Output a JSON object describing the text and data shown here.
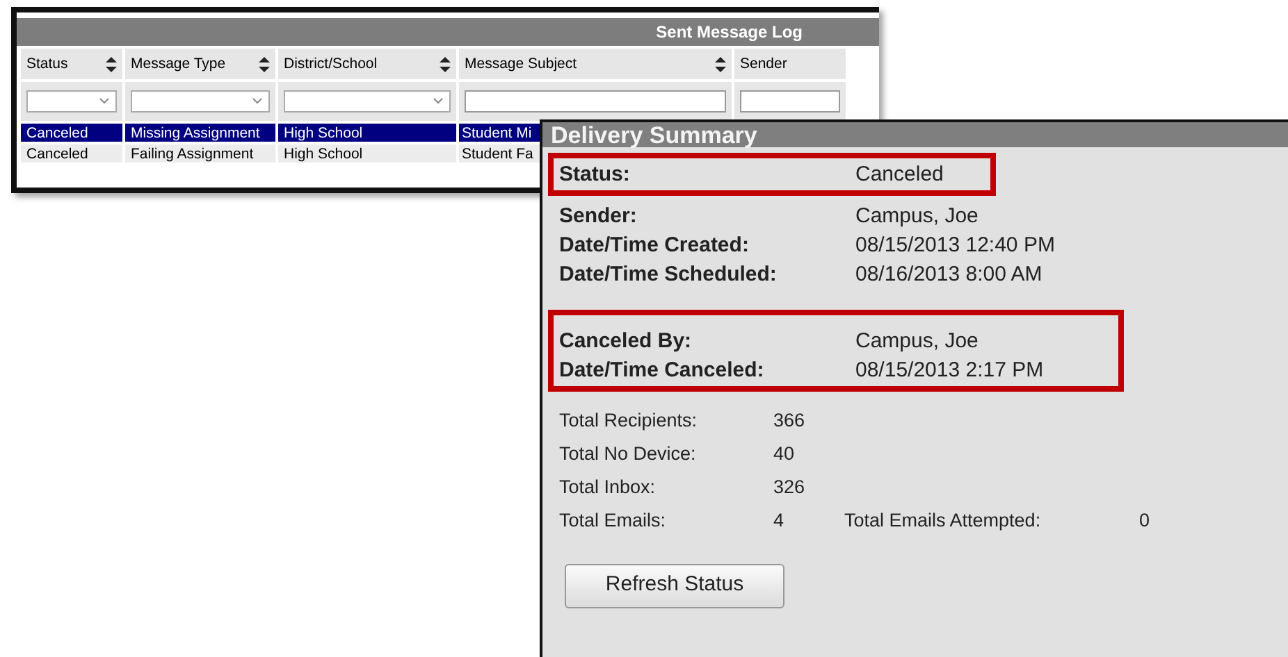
{
  "log_window": {
    "title": "Sent Message Log",
    "columns": [
      {
        "label": "Status",
        "sortable": true,
        "filter": {
          "kind": "dropdown"
        }
      },
      {
        "label": "Message Type",
        "sortable": true,
        "filter": {
          "kind": "dropdown"
        }
      },
      {
        "label": "District/School",
        "sortable": true,
        "filter": {
          "kind": "dropdown"
        }
      },
      {
        "label": "Message Subject",
        "sortable": true,
        "filter": {
          "kind": "text"
        }
      },
      {
        "label": "Sender",
        "sortable": false,
        "filter": {
          "kind": "text"
        }
      }
    ],
    "rows": [
      {
        "selected": true,
        "cells": [
          "Canceled",
          "Missing Assignment",
          "High School",
          "Student Mi"
        ]
      },
      {
        "selected": false,
        "cells": [
          "Canceled",
          "Failing Assignment",
          "High School",
          "Student Fa"
        ]
      }
    ]
  },
  "delivery_summary": {
    "title": "Delivery Summary",
    "groups": [
      {
        "highlighted": true,
        "rows": [
          {
            "label": "Status:",
            "value": "Canceled"
          }
        ]
      },
      {
        "highlighted": false,
        "rows": [
          {
            "label": "Sender:",
            "value": "Campus, Joe"
          },
          {
            "label": "Date/Time Created:",
            "value": "08/15/2013 12:40 PM"
          },
          {
            "label": "Date/Time Scheduled:",
            "value": "08/16/2013 8:00 AM"
          }
        ]
      },
      {
        "highlighted": true,
        "rows": [
          {
            "label": "Canceled By:",
            "value": "Campus, Joe"
          },
          {
            "label": "Date/Time Canceled:",
            "value": "08/15/2013 2:17 PM"
          }
        ]
      }
    ],
    "totals": [
      {
        "label": "Total Recipients:",
        "value": "366"
      },
      {
        "label": "Total No Device:",
        "value": "40"
      },
      {
        "label": "Total Inbox:",
        "value": "326"
      },
      {
        "label": "Total Emails:",
        "value": "4",
        "extra_label": "Total Emails Attempted:",
        "extra_value": "0"
      }
    ],
    "button": "Refresh Status"
  }
}
